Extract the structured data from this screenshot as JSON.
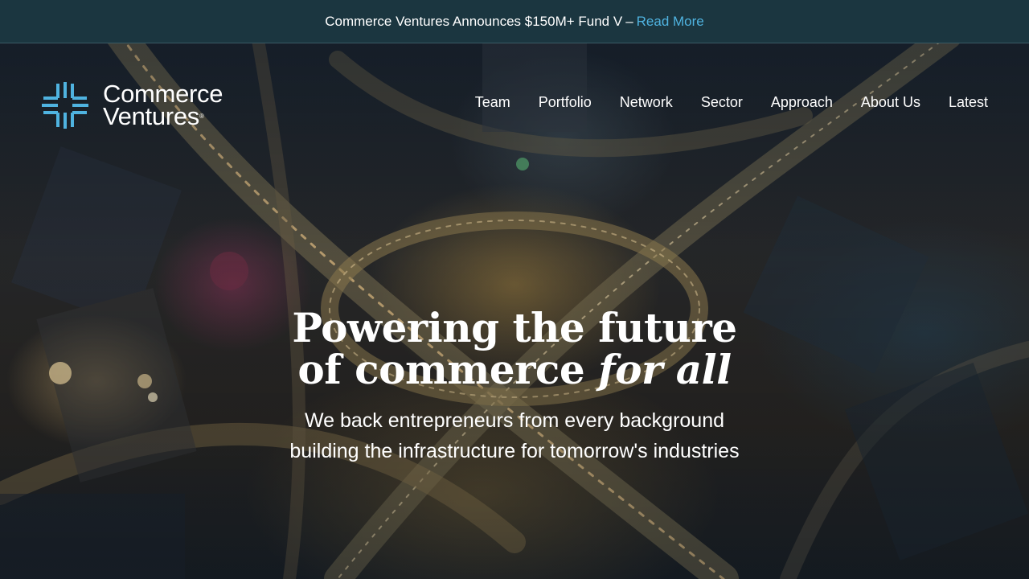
{
  "announcement": {
    "text": "Commerce Ventures Announces $150M+ Fund V",
    "separator": "–",
    "link_label": "Read More"
  },
  "brand": {
    "line1": "Commerce",
    "line2": "Ventures",
    "registered": "®",
    "logo_icon": "commerce-ventures-mark",
    "accent_color": "#4fb3e0"
  },
  "nav": {
    "items": [
      {
        "label": "Team"
      },
      {
        "label": "Portfolio"
      },
      {
        "label": "Network"
      },
      {
        "label": "Sector"
      },
      {
        "label": "Approach"
      },
      {
        "label": "About Us"
      },
      {
        "label": "Latest"
      }
    ]
  },
  "hero": {
    "headline_line1": "Powering the future",
    "headline_line2_prefix": "of commerce ",
    "headline_line2_italic": "for all",
    "subheading": "We back entrepreneurs from every background building the infrastructure for tomorrow's industries"
  },
  "colors": {
    "announcement_bg": "#1b3640",
    "link": "#4fb3e0",
    "text": "#ffffff"
  }
}
